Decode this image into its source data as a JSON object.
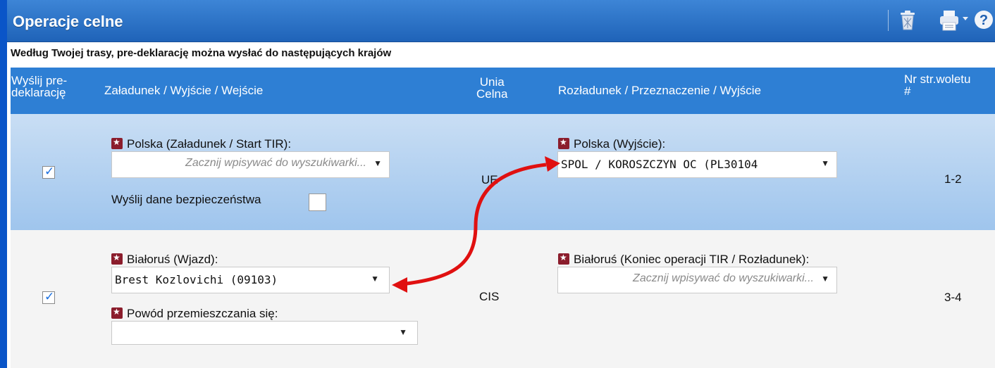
{
  "window": {
    "title": "Operacje celne"
  },
  "toolbar": {
    "icons": [
      "trash-icon",
      "print-icon",
      "help-icon"
    ],
    "print_caret": "·"
  },
  "route_note": "Według Twojej trasy, pre-deklarację można wysłać do następujących krajów",
  "columns": {
    "send": "Wyślij pre-deklarację",
    "send_line1": "Wyślij pre-",
    "send_line2": "deklarację",
    "loading": "Załadunek / Wyjście / Wejście",
    "union_line1": "Unia",
    "union_line2": "Celna",
    "unloading": "Rozładunek / Przeznaczenie / Wyjście",
    "pages_line1": "Nr str.woletu",
    "pages_line2": "#"
  },
  "rows": [
    {
      "checked": true,
      "loading_label": "Polska (Załadunek / Start TIR):",
      "loading_placeholder": "Zacznij wpisywać do wyszukiwarki...",
      "security_label": "Wyślij dane bezpieczeństwa",
      "security_checked": false,
      "union": "UE",
      "unloading_label": "Polska (Wyjście):",
      "unloading_value": "SPOL /  KOROSZCZYN OC (PL30104",
      "pages": "1-2"
    },
    {
      "checked": true,
      "loading_label": "Białoruś (Wjazd):",
      "loading_value": "Brest Kozlovichi (09103)",
      "reason_label": "Powód przemieszczania się:",
      "reason_value": "",
      "union": "CIS",
      "unloading_label": "Białoruś (Koniec operacji TIR / Rozładunek):",
      "unloading_placeholder": "Zacznij wpisywać do wyszukiwarki...",
      "pages": "3-4"
    }
  ],
  "colors": {
    "frame": "#0a55c8",
    "title_bar": "#2e72c6",
    "header": "#2e7fd4",
    "row1_bg": "#b3d2f1",
    "row2_bg": "#f4f4f4",
    "required_badge": "#8b1d2c",
    "annotation_arrow": "#e01010"
  }
}
